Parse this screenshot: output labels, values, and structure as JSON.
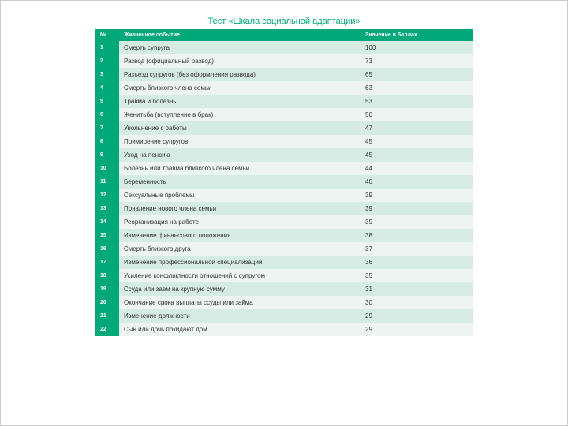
{
  "title": "Тест «Шкала социальной адаптации»",
  "columns": {
    "num": "№",
    "event": "Жизненное событие",
    "score": "Значение в баллах"
  },
  "rows": [
    {
      "n": "1",
      "e": "Смерть супруга",
      "s": "100"
    },
    {
      "n": "2",
      "e": "Развод (официальный развод)",
      "s": "73"
    },
    {
      "n": "3",
      "e": "Разъезд супругов (без оформления развода)",
      "s": "65"
    },
    {
      "n": "4",
      "e": "Смерть близкого члена семьи",
      "s": "63"
    },
    {
      "n": "5",
      "e": "Травма и болезнь",
      "s": "53"
    },
    {
      "n": "6",
      "e": "Женитьба (вступление в брак)",
      "s": "50"
    },
    {
      "n": "7",
      "e": "Увольнение с работы",
      "s": "47"
    },
    {
      "n": "8",
      "e": "Примирение супругов",
      "s": "45"
    },
    {
      "n": "9",
      "e": "Уход на пенсию",
      "s": "45"
    },
    {
      "n": "10",
      "e": "Болезнь или травма близкого члена семьи",
      "s": "44"
    },
    {
      "n": "11",
      "e": "Беременность",
      "s": "40"
    },
    {
      "n": "12",
      "e": "Сексуальные проблемы",
      "s": "39"
    },
    {
      "n": "13",
      "e": "Появление нового члена семьи",
      "s": "39"
    },
    {
      "n": "14",
      "e": "Реорганизация на работе",
      "s": "39"
    },
    {
      "n": "15",
      "e": "Изменение финансового положения",
      "s": "38"
    },
    {
      "n": "16",
      "e": "Смерть близкого друга",
      "s": "37"
    },
    {
      "n": "17",
      "e": "Изменение профессиональной специализации",
      "s": "36"
    },
    {
      "n": "18",
      "e": "Усиление конфликтности отношений с супругом",
      "s": "35"
    },
    {
      "n": "19",
      "e": "Ссуда или заем на крупную сумму",
      "s": "31"
    },
    {
      "n": "20",
      "e": "Окончание срока выплаты ссуды или займа",
      "s": "30"
    },
    {
      "n": "21",
      "e": "Изменение должности",
      "s": "29"
    },
    {
      "n": "22",
      "e": "Сын или дочь покидают дом",
      "s": "29"
    }
  ]
}
